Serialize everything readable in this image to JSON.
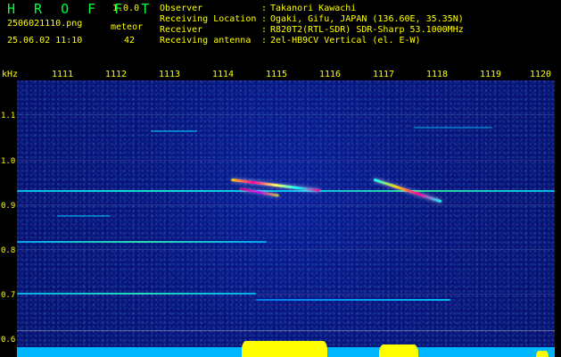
{
  "header": {
    "title": "H R O F F T",
    "version": "1.0.0",
    "filename": "2506021110.png",
    "meteor_label": "meteor",
    "timestamp": "25.06.02 11:10",
    "meteor_count": "42",
    "observer_label": "Observer",
    "observer_value": "Takanori Kawachi",
    "location_label": "Receiving Location",
    "location_value": "Ogaki, Gifu, JAPAN (136.60E, 35.35N)",
    "receiver_label": "Receiver",
    "receiver_value": "R820T2(RTL-SDR) SDR-Sharp 53.1000MHz",
    "antenna_label": "Receiving antenna",
    "antenna_value": "2el-HB9CV Vertical (el. E-W)"
  },
  "axes": {
    "unit_label": "kHz",
    "x_ticks": [
      "1111",
      "1112",
      "1113",
      "1114",
      "1115",
      "1116",
      "1117",
      "1118",
      "1119",
      "1120"
    ],
    "y_ticks": [
      "1.1",
      "1.0",
      "0.9",
      "0.8",
      "0.7",
      "0.6"
    ]
  },
  "colors": {
    "label_yellow": "#ffff00",
    "brand_green": "#00ff40",
    "spectrogram_blue": "#071580",
    "noise_cyan": "#00b7ff",
    "meteor_magenta": "#ff00a0"
  }
}
